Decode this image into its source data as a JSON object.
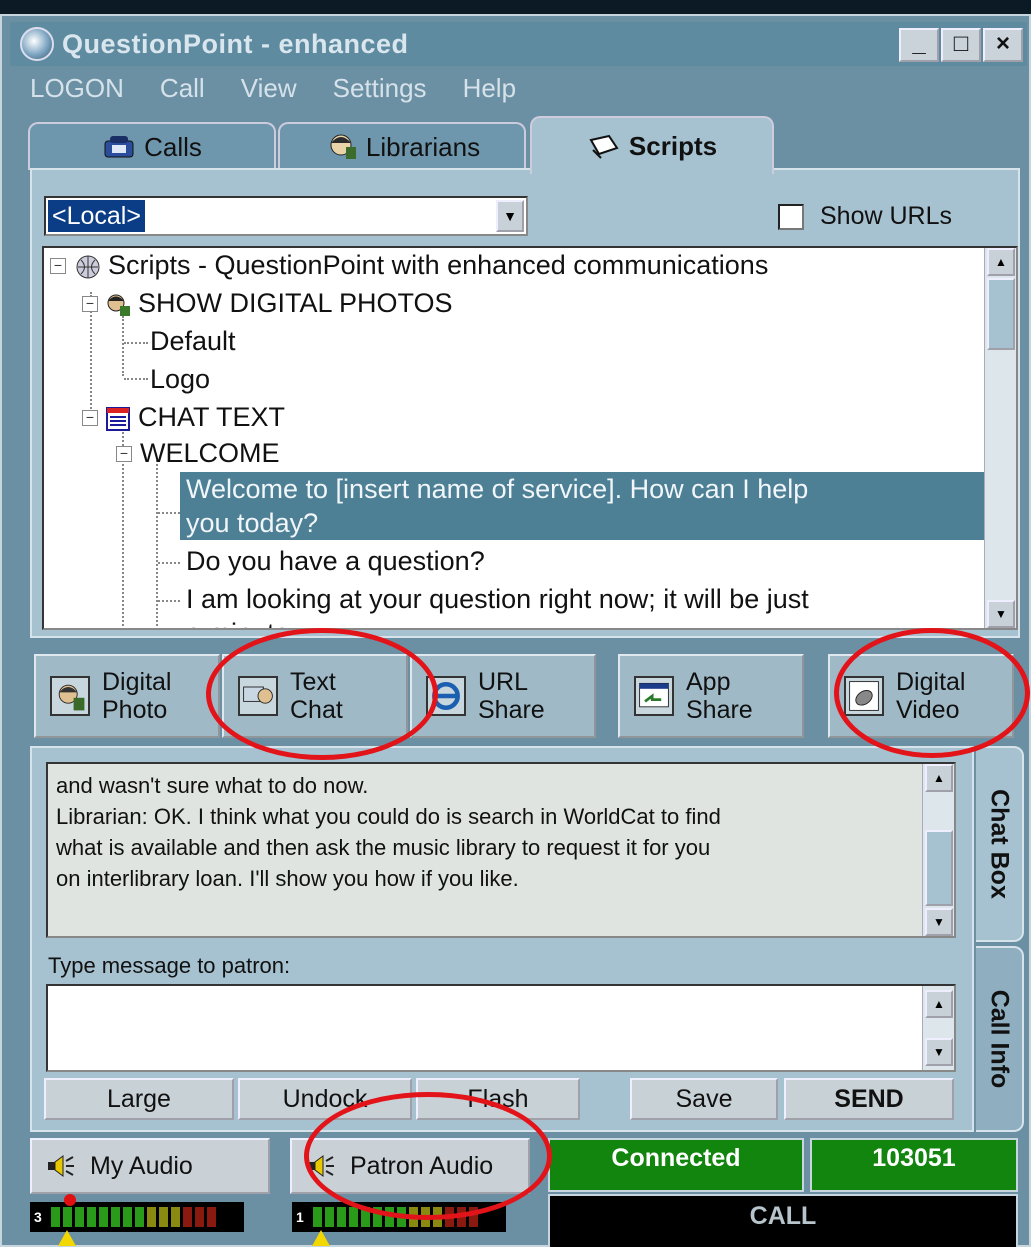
{
  "window": {
    "title": "QuestionPoint - enhanced",
    "minimize": "_",
    "maximize": "□",
    "close": "×"
  },
  "menu": [
    "LOGON",
    "Call",
    "View",
    "Settings",
    "Help"
  ],
  "tabs": [
    {
      "label": "Calls",
      "icon": "phone-icon"
    },
    {
      "label": "Librarians",
      "icon": "librarian-icon"
    },
    {
      "label": "Scripts",
      "icon": "scripts-icon",
      "active": true
    }
  ],
  "scripts": {
    "source_select": "<Local>",
    "show_urls_label": "Show URLs",
    "show_urls_checked": false,
    "tree": {
      "root": "Scripts - QuestionPoint with enhanced communications",
      "show_photos": "SHOW DIGITAL PHOTOS",
      "default": "Default",
      "logo": "Logo",
      "chat_text": "CHAT TEXT",
      "welcome": "WELCOME",
      "item1": "Welcome to [insert name of service]. How can I help",
      "item1b": "you today?",
      "item2": "Do you have a question?",
      "item3": "I am looking at your question right now; it will be just",
      "item3b": "a minute"
    }
  },
  "tools": [
    {
      "line1": "Digital",
      "line2": "Photo",
      "icon": "photo-icon"
    },
    {
      "line1": "Text",
      "line2": "Chat",
      "icon": "chat-icon"
    },
    {
      "line1": "URL",
      "line2": "Share",
      "icon": "browser-icon"
    },
    {
      "line1": "App",
      "line2": "Share",
      "icon": "app-share-icon"
    },
    {
      "line1": "Digital",
      "line2": "Video",
      "icon": "video-icon"
    }
  ],
  "chat": {
    "transcript": [
      "and wasn't sure what to do now.",
      "Librarian: OK.  I think what you could do is search in WorldCat to find",
      "what is available and then ask the music library to request it for you",
      "on interlibrary loan.  I'll show you how if you like."
    ],
    "type_label": "Type message to patron:",
    "buttons": {
      "large": "Large",
      "undock": "Undock",
      "flash": "Flash",
      "save": "Save",
      "send": "SEND"
    }
  },
  "side_tabs": {
    "chat_box": "Chat Box",
    "call_info": "Call Info"
  },
  "audio": {
    "my_audio": "My Audio",
    "patron_audio": "Patron Audio",
    "my_level_num": "3",
    "patron_level_num": "1"
  },
  "status": {
    "connected": "Connected",
    "call_id": "103051",
    "call": "CALL"
  },
  "colors": {
    "connected_bg": "#11850e",
    "selection": "#4d7f95",
    "annotation": "#e2141a"
  }
}
